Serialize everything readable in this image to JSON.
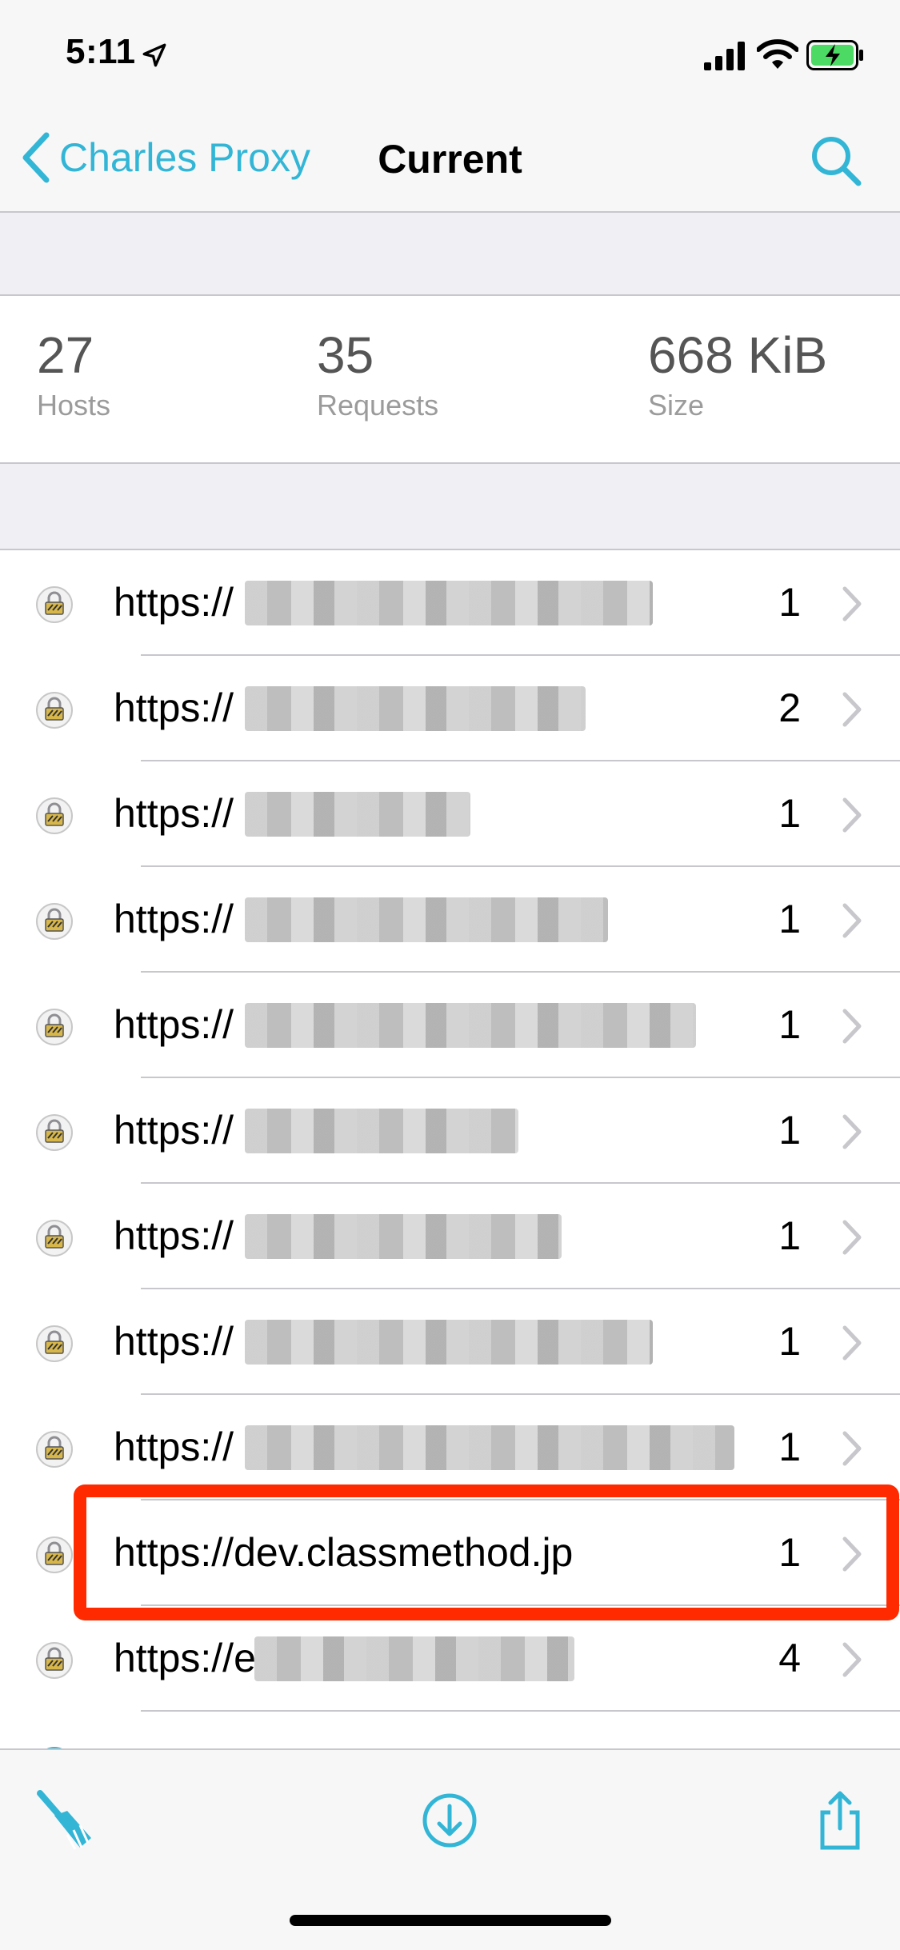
{
  "status": {
    "time": "5:11"
  },
  "nav": {
    "back_label": "Charles Proxy",
    "title": "Current"
  },
  "stats": [
    {
      "value": "27",
      "label": "Hosts"
    },
    {
      "value": "35",
      "label": "Requests"
    },
    {
      "value": "668 KiB",
      "label": "Size"
    }
  ],
  "hosts": [
    {
      "prefix": "https://",
      "count": "1"
    },
    {
      "prefix": "https://",
      "count": "2"
    },
    {
      "prefix": "https://",
      "count": "1"
    },
    {
      "prefix": "https://",
      "count": "1"
    },
    {
      "prefix": "https://",
      "count": "1"
    },
    {
      "prefix": "https://",
      "count": "1"
    },
    {
      "prefix": "https://",
      "count": "1"
    },
    {
      "prefix": "https://",
      "count": "1"
    },
    {
      "prefix": "https://",
      "count": "1"
    },
    {
      "prefix": "https://dev.classmethod.jp",
      "count": "1"
    },
    {
      "prefix": "https://e",
      "count": "4"
    }
  ],
  "colors": {
    "accent": "#33b6d6",
    "highlight": "#ff2a00",
    "battery": "#4cd964"
  },
  "icons": [
    "location-arrow-icon",
    "signal-icon",
    "wifi-icon",
    "battery-icon",
    "chevron-left-icon",
    "search-icon",
    "lock-icon",
    "chevron-right-icon",
    "broom-icon",
    "download-icon",
    "share-icon"
  ]
}
